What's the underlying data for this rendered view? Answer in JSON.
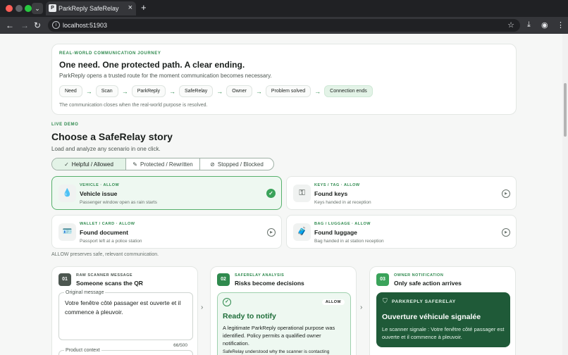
{
  "browser": {
    "tab_title": "ParkReply SafeRelay",
    "url": "localhost:51903"
  },
  "journey": {
    "eyebrow": "REAL-WORLD COMMUNICATION JOURNEY",
    "title": "One need. One protected path. A clear ending.",
    "lead": "ParkReply opens a trusted route for the moment communication becomes necessary.",
    "steps": [
      "Need",
      "Scan",
      "ParkReply",
      "SafeRelay",
      "Owner",
      "Problem solved",
      "Connection ends"
    ],
    "footnote": "The communication closes when the real-world purpose is resolved."
  },
  "demo": {
    "eyebrow": "LIVE DEMO",
    "title": "Choose a SafeRelay story",
    "subtitle": "Load and analyze any scenario in one click.",
    "filters": [
      {
        "label": "Helpful / Allowed",
        "icon": "check-circle-icon",
        "active": true
      },
      {
        "label": "Protected / Rewritten",
        "icon": "magic-wand-icon",
        "active": false
      },
      {
        "label": "Stopped / Blocked",
        "icon": "blocked-icon",
        "active": false
      }
    ],
    "stories": [
      {
        "tag": "VEHICLE · ALLOW",
        "name": "Vehicle issue",
        "desc": "Passenger window open as rain starts",
        "icon": "raindrop-icon",
        "selected": true
      },
      {
        "tag": "KEYS / TAG · ALLOW",
        "name": "Found keys",
        "desc": "Keys handed in at reception",
        "icon": "key-icon",
        "selected": false
      },
      {
        "tag": "WALLET / CARD · ALLOW",
        "name": "Found document",
        "desc": "Passport left at a police station",
        "icon": "id-card-icon",
        "selected": false
      },
      {
        "tag": "BAG / LUGGAGE · ALLOW",
        "name": "Found luggage",
        "desc": "Bag handed in at station reception",
        "icon": "luggage-icon",
        "selected": false
      }
    ],
    "note": "ALLOW preserves safe, relevant communication."
  },
  "pipeline": {
    "scanner": {
      "num": "01",
      "tag": "RAW SCANNER MESSAGE",
      "title": "Someone scans the QR",
      "field_label": "Original message",
      "message": "Votre fenêtre côté passager est ouverte et il commence à pleuvoir.",
      "counter": "66/500",
      "context_label": "Product context"
    },
    "analysis": {
      "num": "02",
      "tag": "SAFERELAY ANALYSIS",
      "title": "Risks become decisions",
      "badge": "ALLOW",
      "result_title": "Ready to notify",
      "result_body": "A legitimate ParkReply operational purpose was identified. Policy permits a qualified owner notification.",
      "result_more": "SafeRelay understood why the scanner is contacting"
    },
    "notification": {
      "num": "03",
      "tag": "OWNER NOTIFICATION",
      "title": "Only safe action arrives",
      "brand": "PARKREPLY SAFERELAY",
      "notif_title": "Ouverture véhicule signalée",
      "notif_body": "Le scanner signale : Votre fenêtre côté passager est ouverte et il commence à pleuvoir."
    }
  },
  "colors": {
    "accent": "#2f8a4e",
    "selected_bg": "#eef8f1",
    "notification_bg": "#1f5a38"
  }
}
